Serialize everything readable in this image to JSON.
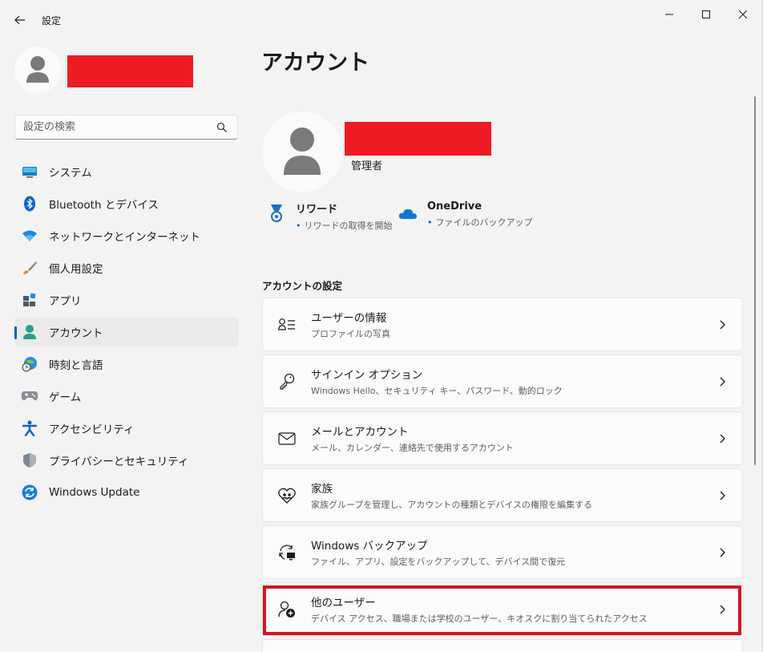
{
  "window": {
    "title": "設定",
    "back_icon": "arrow-left-icon",
    "controls": [
      "minimize-icon",
      "maximize-icon",
      "close-icon"
    ]
  },
  "search": {
    "placeholder": "設定の検索",
    "icon": "search-icon"
  },
  "sidebar": {
    "items": [
      {
        "label": "システム",
        "icon": "system-monitor-icon"
      },
      {
        "label": "Bluetooth とデバイス",
        "icon": "bluetooth-icon"
      },
      {
        "label": "ネットワークとインターネット",
        "icon": "wifi-icon"
      },
      {
        "label": "個人用設定",
        "icon": "brush-icon"
      },
      {
        "label": "アプリ",
        "icon": "apps-icon"
      },
      {
        "label": "アカウント",
        "icon": "account-icon",
        "active": true
      },
      {
        "label": "時刻と言語",
        "icon": "globe-clock-icon"
      },
      {
        "label": "ゲーム",
        "icon": "gamepad-icon"
      },
      {
        "label": "アクセシビリティ",
        "icon": "accessibility-icon"
      },
      {
        "label": "プライバシーとセキュリティ",
        "icon": "shield-icon"
      },
      {
        "label": "Windows Update",
        "icon": "windows-update-icon"
      }
    ]
  },
  "main": {
    "title": "アカウント",
    "profile": {
      "role": "管理者"
    },
    "services": [
      {
        "title": "リワード",
        "subtitle": "リワードの取得を開始",
        "icon": "rewards-medal-icon"
      },
      {
        "title": "OneDrive",
        "subtitle": "ファイルのバックアップ",
        "icon": "onedrive-cloud-icon"
      }
    ],
    "section_title": "アカウントの設定",
    "cards": [
      {
        "title": "ユーザーの情報",
        "subtitle": "プロファイルの写真",
        "icon": "user-info-icon"
      },
      {
        "title": "サインイン オプション",
        "subtitle": "Windows Hello、セキュリティ キー、パスワード、動的ロック",
        "icon": "key-icon"
      },
      {
        "title": "メールとアカウント",
        "subtitle": "メール、カレンダー、連絡先で使用するアカウント",
        "icon": "mail-icon"
      },
      {
        "title": "家族",
        "subtitle": "家族グループを管理し、アカウントの種類とデバイスの権限を編集する",
        "icon": "family-heart-icon"
      },
      {
        "title": "Windows バックアップ",
        "subtitle": "ファイル、アプリ、設定をバックアップして、デバイス間で復元",
        "icon": "backup-sync-icon"
      },
      {
        "title": "他のユーザー",
        "subtitle": "デバイス アクセス、職場または学校のユーザー、キオスクに割り当てられたアクセス",
        "icon": "add-user-icon"
      }
    ]
  },
  "colors": {
    "accent": "#005fb8",
    "redaction": "#ed1c24",
    "highlight_border": "#d3161f",
    "background": "#f3f3f3",
    "card": "#fbfbfb"
  }
}
